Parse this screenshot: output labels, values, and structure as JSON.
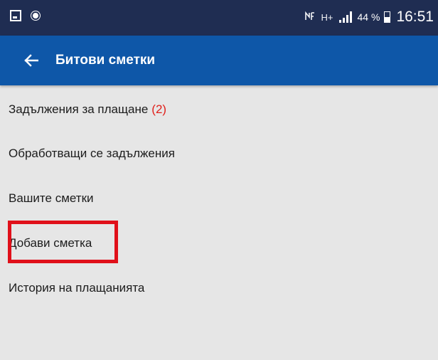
{
  "status_bar": {
    "left_icons": [
      "notification-image-icon",
      "shield-icon"
    ],
    "network_text": "H+",
    "battery_text": "44 %",
    "time": "16:51"
  },
  "app_bar": {
    "title": "Битови сметки",
    "back_icon": "arrow-left-icon"
  },
  "menu": {
    "items": [
      {
        "label": "Задължения за плащане",
        "count": "(2)"
      },
      {
        "label": "Обработващи се задължения"
      },
      {
        "label": "Вашите сметки"
      },
      {
        "label": "Добави сметка",
        "highlighted": true
      },
      {
        "label": "История на плащанията"
      }
    ]
  },
  "colors": {
    "status_bar_bg": "#1f2d52",
    "app_bar_bg": "#0e57a8",
    "page_bg": "#e6e6e6",
    "count_color": "#e0201b",
    "highlight_border": "#e0101a"
  }
}
